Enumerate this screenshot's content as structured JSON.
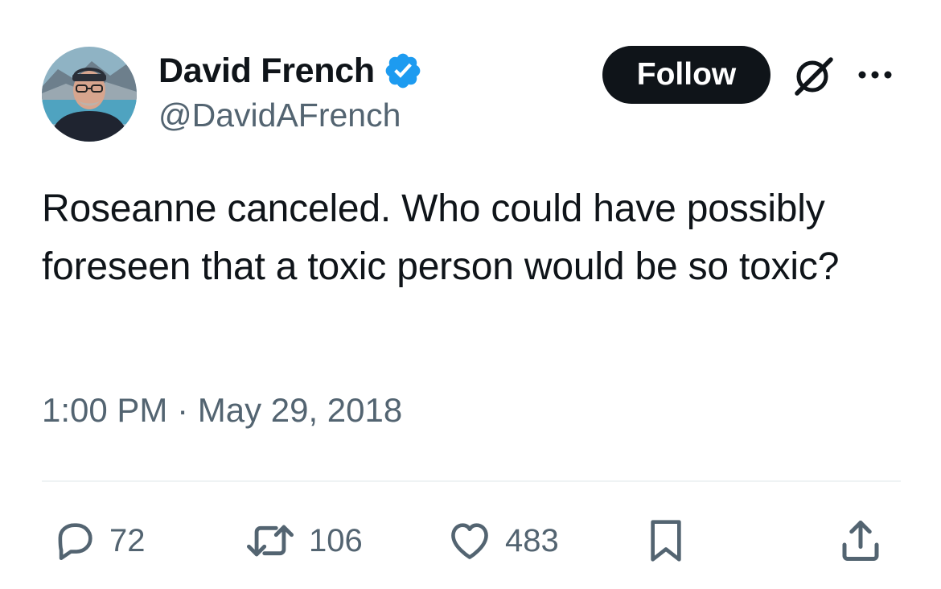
{
  "author": {
    "display_name": "David French",
    "handle": "@DavidAFrench",
    "verified": true
  },
  "header": {
    "follow_label": "Follow"
  },
  "tweet": {
    "text": "Roseanne canceled. Who could have possibly foreseen that a toxic person would be so toxic?",
    "timestamp": "1:00 PM · May 29, 2018"
  },
  "stats": {
    "replies": "72",
    "retweets": "106",
    "likes": "483"
  },
  "icons": {
    "verified": "verified-badge-icon",
    "grok": "grok-icon",
    "more": "more-icon",
    "reply": "reply-icon",
    "retweet": "retweet-icon",
    "like": "heart-icon",
    "bookmark": "bookmark-icon",
    "share": "share-icon"
  },
  "colors": {
    "text": "#0f1419",
    "secondary": "#536471",
    "verified_blue": "#1d9bf0",
    "follow_bg": "#0f1419",
    "divider": "#eff3f4"
  }
}
